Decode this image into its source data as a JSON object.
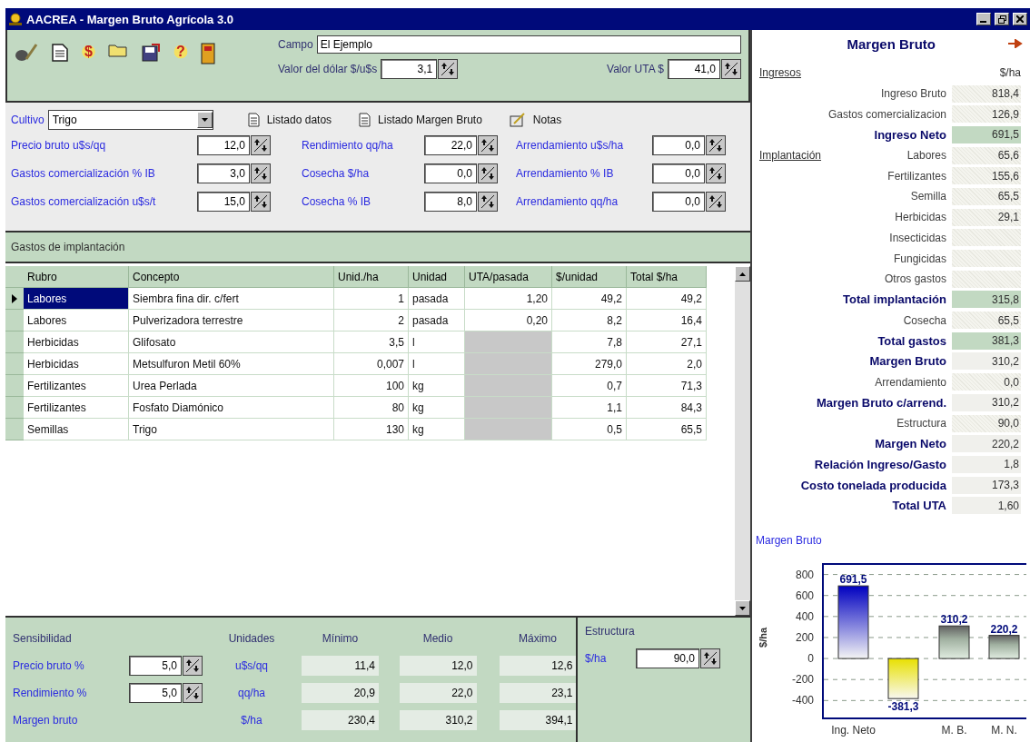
{
  "window": {
    "title": "AACREA - Margen Bruto Agrícola 3.0"
  },
  "toolbar": {
    "icons": [
      {
        "kind": "brush"
      },
      {
        "kind": "document"
      },
      {
        "kind": "glyph",
        "glyph": "$"
      },
      {
        "kind": "folder"
      },
      {
        "kind": "disk"
      },
      {
        "kind": "glyph",
        "glyph": "?"
      },
      {
        "kind": "book"
      }
    ],
    "campo": {
      "label": "Campo",
      "value": "El Ejemplo"
    },
    "dolar": {
      "label": "Valor del dólar $/u$s",
      "value": "3,1"
    },
    "uta": {
      "label": "Valor UTA $",
      "value": "41,0"
    }
  },
  "cultivo": {
    "label": "Cultivo",
    "value": "Trigo",
    "buttons": [
      {
        "kind": "document",
        "label": "Listado datos"
      },
      {
        "kind": "document",
        "label": "Listado Margen Bruto"
      },
      {
        "kind": "notes",
        "label": "Notas"
      }
    ],
    "fields": [
      {
        "label": "Precio bruto u$s/qq",
        "value": "12,0"
      },
      {
        "label": "Rendimiento qq/ha",
        "value": "22,0"
      },
      {
        "label": "Arrendamiento u$s/ha",
        "value": "0,0"
      },
      {
        "label": "Gastos comercialización % IB",
        "value": "3,0"
      },
      {
        "label": "Cosecha $/ha",
        "value": "0,0"
      },
      {
        "label": "Arrendamiento % IB",
        "value": "0,0"
      },
      {
        "label": "Gastos comercialización u$s/t",
        "value": "15,0"
      },
      {
        "label": "Cosecha % IB",
        "value": "8,0"
      },
      {
        "label": "Arrendamiento qq/ha",
        "value": "0,0"
      }
    ]
  },
  "gastos": {
    "title": "Gastos de implantación",
    "columns": [
      "Rubro",
      "Concepto",
      "Unid./ha",
      "Unidad",
      "UTA/pasada",
      "$/unidad",
      "Total $/ha"
    ],
    "rows": [
      {
        "selected": true,
        "cells": [
          "Labores",
          "Siembra fina dir. c/fert",
          "1",
          "pasada",
          "1,20",
          "49,2",
          "49,2"
        ],
        "uta_disabled": false
      },
      {
        "selected": false,
        "cells": [
          "Labores",
          "Pulverizadora terrestre",
          "2",
          "pasada",
          "0,20",
          "8,2",
          "16,4"
        ],
        "uta_disabled": false
      },
      {
        "selected": false,
        "cells": [
          "Herbicidas",
          "Glifosato",
          "3,5",
          "l",
          null,
          "7,8",
          "27,1"
        ],
        "uta_disabled": true
      },
      {
        "selected": false,
        "cells": [
          "Herbicidas",
          "Metsulfuron Metil 60%",
          "0,007",
          "l",
          null,
          "279,0",
          "2,0"
        ],
        "uta_disabled": true
      },
      {
        "selected": false,
        "cells": [
          "Fertilizantes",
          "Urea Perlada",
          "100",
          "kg",
          null,
          "0,7",
          "71,3"
        ],
        "uta_disabled": true
      },
      {
        "selected": false,
        "cells": [
          "Fertilizantes",
          "Fosfato Diamónico",
          "80",
          "kg",
          null,
          "1,1",
          "84,3"
        ],
        "uta_disabled": true
      },
      {
        "selected": false,
        "cells": [
          "Semillas",
          "Trigo",
          "130",
          "kg",
          null,
          "0,5",
          "65,5"
        ],
        "uta_disabled": true
      }
    ]
  },
  "sensibilidad": {
    "title": "Sensibilidad",
    "columns": [
      "Unidades",
      "Mínimo",
      "Medio",
      "Máximo"
    ],
    "rows": [
      {
        "label": "Precio bruto %",
        "value": "5,0",
        "unit": "u$s/qq",
        "min": "11,4",
        "mid": "12,0",
        "max": "12,6"
      },
      {
        "label": "Rendimiento %",
        "value": "5,0",
        "unit": "qq/ha",
        "min": "20,9",
        "mid": "22,0",
        "max": "23,1"
      },
      {
        "label": "Margen bruto",
        "unit": "$/ha",
        "min": "230,4",
        "mid": "310,2",
        "max": "394,1"
      }
    ],
    "estructura": {
      "title": "Estructura",
      "label": "$/ha",
      "value": "90,0"
    }
  },
  "resumen": {
    "title": "Margen Bruto",
    "section": "Ingresos",
    "unit": "$/ha",
    "rows": [
      {
        "label": "Ingreso Bruto",
        "value": "818,4",
        "bold": false,
        "kind": "dotted"
      },
      {
        "label": "Gastos comercializacion",
        "value": "126,9",
        "bold": false,
        "kind": "dotted"
      },
      {
        "label": "Ingreso Neto",
        "value": "691,5",
        "bold": true,
        "kind": "green"
      },
      {
        "section": "Implantación",
        "label": "Labores",
        "value": "65,6",
        "bold": false,
        "kind": "dotted"
      },
      {
        "label": "Fertilizantes",
        "value": "155,6",
        "bold": false,
        "kind": "dotted"
      },
      {
        "label": "Semilla",
        "value": "65,5",
        "bold": false,
        "kind": "dotted"
      },
      {
        "label": "Herbicidas",
        "value": "29,1",
        "bold": false,
        "kind": "dotted"
      },
      {
        "label": "Insecticidas",
        "bold": false,
        "kind": "dotted"
      },
      {
        "label": "Fungicidas",
        "bold": false,
        "kind": "dotted"
      },
      {
        "label": "Otros gastos",
        "bold": false,
        "kind": "dotted"
      },
      {
        "label": "Total implantación",
        "value": "315,8",
        "bold": true,
        "kind": "green"
      },
      {
        "label": "Cosecha",
        "value": "65,5",
        "bold": false,
        "kind": "dotted"
      },
      {
        "label": "Total gastos",
        "value": "381,3",
        "bold": true,
        "kind": "green"
      },
      {
        "label": "Margen Bruto",
        "value": "310,2",
        "bold": true,
        "kind": "plain"
      },
      {
        "label": "Arrendamiento",
        "value": "0,0",
        "bold": false,
        "kind": "dotted"
      },
      {
        "label": "Margen Bruto c/arrend.",
        "value": "310,2",
        "bold": true,
        "kind": "plain"
      },
      {
        "label": "Estructura",
        "value": "90,0",
        "bold": false,
        "kind": "dotted"
      },
      {
        "label": "Margen Neto",
        "value": "220,2",
        "bold": true,
        "kind": "plain"
      },
      {
        "label": "Relación Ingreso/Gasto",
        "value": "1,8",
        "bold": true,
        "kind": "plain"
      },
      {
        "label": "Costo tonelada producida",
        "value": "173,3",
        "bold": true,
        "kind": "plain"
      },
      {
        "label": "Total UTA",
        "value": "1,60",
        "bold": true,
        "kind": "plain"
      }
    ],
    "chart_data": {
      "type": "bar",
      "title": "Margen Bruto",
      "ylabel": "$/ha",
      "categories": [
        "Ing. Neto",
        null,
        "M. B.",
        "M. N."
      ],
      "series": [
        {
          "values": [
            691.5,
            -381.3,
            310.2,
            220.2
          ]
        }
      ],
      "value_labels": [
        "691,5",
        "-381,3",
        "310,2",
        "220,2"
      ],
      "ylim": [
        -570,
        900
      ],
      "yticks": [
        800,
        600,
        400,
        200,
        0,
        -200,
        -400
      ],
      "grid": true
    }
  }
}
